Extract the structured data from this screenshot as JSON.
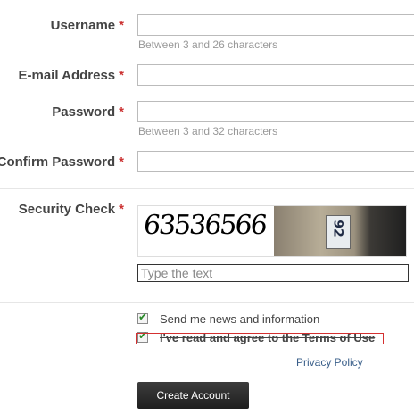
{
  "form": {
    "username": {
      "label": "Username",
      "required_mark": "*",
      "value": "",
      "hint": "Between 3 and 26 characters"
    },
    "email": {
      "label": "E-mail Address",
      "required_mark": "*",
      "value": ""
    },
    "password": {
      "label": "Password",
      "required_mark": "*",
      "value": "",
      "hint": "Between 3 and 32 characters"
    },
    "confirm_password": {
      "label": "Confirm Password",
      "required_mark": "*",
      "value": ""
    },
    "security_check": {
      "label": "Security Check",
      "required_mark": "*",
      "captcha_word": "63536566",
      "captcha_number": "92",
      "input_placeholder": "Type the text",
      "input_value": ""
    },
    "newsletter": {
      "label": "Send me news and information",
      "checked": true
    },
    "terms": {
      "label": "I've read and agree to the Terms of Use",
      "checked": true
    },
    "privacy_link": "Privacy Policy",
    "submit_label": "Create Account"
  },
  "colors": {
    "required_star": "#cc3333",
    "checkbox_tick": "#2a8a2a",
    "terms_highlight": "#d43030",
    "link": "#3a5f8a",
    "button_bg": "#2a2a2a"
  },
  "icons": {
    "checkbox_tick": "check-icon"
  }
}
